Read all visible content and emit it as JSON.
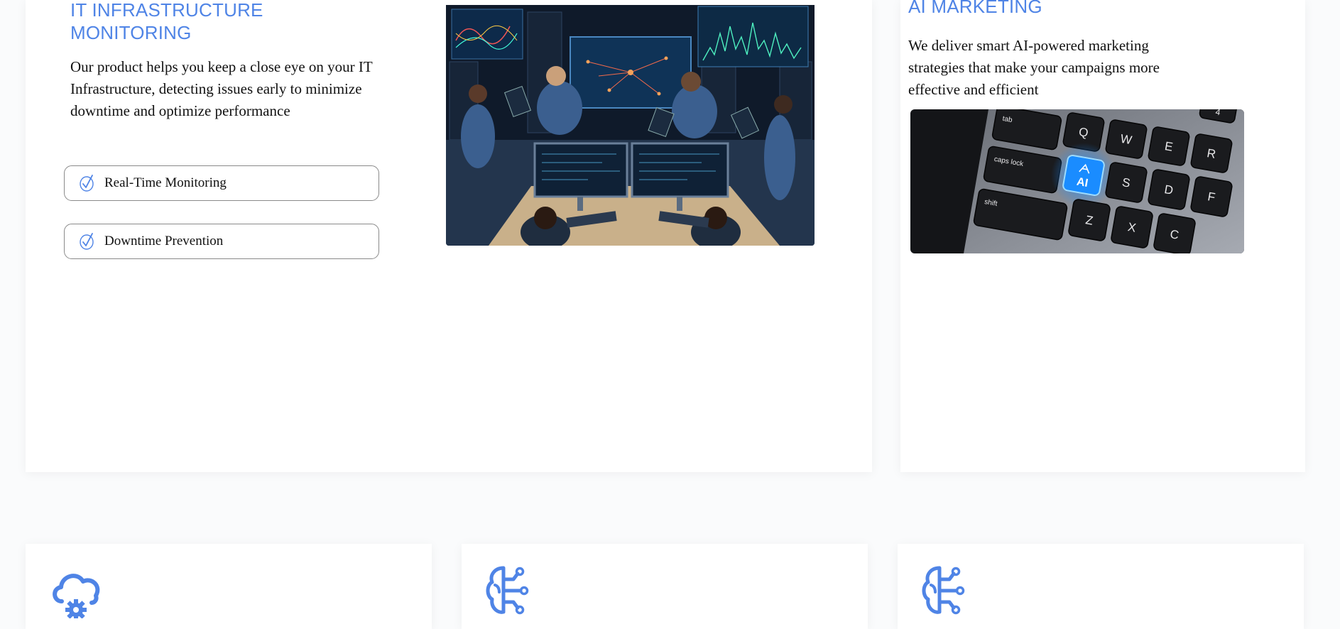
{
  "it_section": {
    "title": "IT INFRASTRUCTURE MONITORING",
    "description_lines": [
      "Our product helps you keep a close eye on your IT",
      "Infrastructure, detecting issues early to minimize downtime and optimize performance"
    ],
    "features": [
      {
        "label": "Real-Time Monitoring",
        "icon": "check-icon"
      },
      {
        "label": "Downtime Prevention",
        "icon": "check-icon"
      }
    ],
    "image": {
      "icon": "team-monitoring-image"
    }
  },
  "ai_section": {
    "title": "AI MARKETING",
    "description": "We deliver smart AI-powered marketing strategies that make your campaigns more effective and efficient",
    "image": {
      "icon": "ai-keyboard-image",
      "keys": [
        "tab",
        "Q",
        "W",
        "E",
        "R",
        "caps lock",
        "AI",
        "S",
        "D",
        "F",
        "shift",
        "Z",
        "X",
        "C",
        "4"
      ]
    }
  },
  "services": [
    {
      "icon": "cloud-gear-icon"
    },
    {
      "icon": "brain-circuit-icon"
    },
    {
      "icon": "brain-circuit-icon"
    }
  ],
  "colors": {
    "accent": "#4f84e6",
    "text": "#111111",
    "border": "#8a8a8a",
    "key_glow": "#1a8cff"
  }
}
